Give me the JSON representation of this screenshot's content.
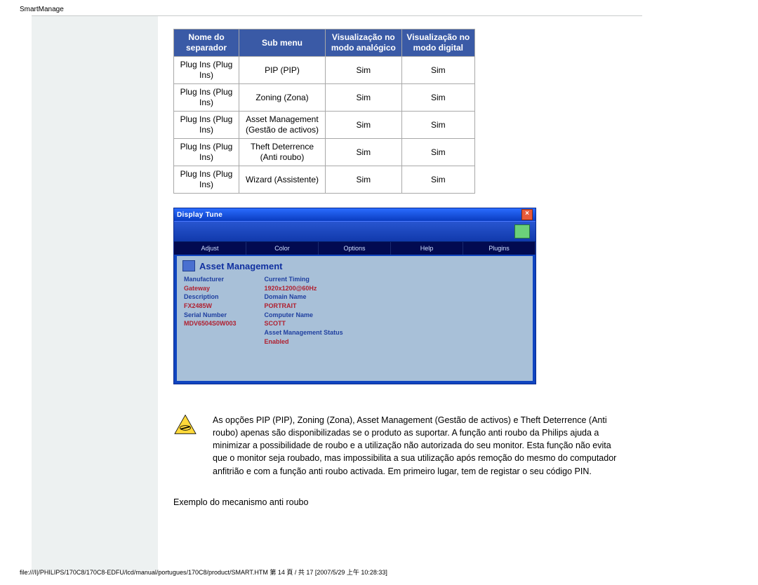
{
  "header": "SmartManage",
  "table": {
    "headers": [
      "Nome do separador",
      "Sub menu",
      "Visualização no modo analógico",
      "Visualização no modo digital"
    ],
    "rows": [
      [
        "Plug Ins (Plug Ins)",
        "PIP (PIP)",
        "Sim",
        "Sim"
      ],
      [
        "Plug Ins (Plug Ins)",
        "Zoning (Zona)",
        "Sim",
        "Sim"
      ],
      [
        "Plug Ins (Plug Ins)",
        "Asset Management (Gestão de activos)",
        "Sim",
        "Sim"
      ],
      [
        "Plug Ins (Plug Ins)",
        "Theft Deterrence (Anti roubo)",
        "Sim",
        "Sim"
      ],
      [
        "Plug Ins (Plug Ins)",
        "Wizard (Assistente)",
        "Sim",
        "Sim"
      ]
    ]
  },
  "shot": {
    "title": "Display Tune",
    "close": "×",
    "tabs": [
      "Adjust",
      "Color",
      "Options",
      "Help",
      "Plugins"
    ],
    "pane_title": "Asset Management",
    "left": [
      {
        "k": "Manufacturer",
        "v": "Gateway"
      },
      {
        "k": "Description",
        "v": "FX2485W"
      },
      {
        "k": "Serial Number",
        "v": "MDV6504S0W003"
      }
    ],
    "right": [
      {
        "k": "Current Timing",
        "v": "1920x1200@60Hz"
      },
      {
        "k": "Domain Name",
        "v": "PORTRAIT"
      },
      {
        "k": "Computer Name",
        "v": "SCOTT"
      },
      {
        "k": "Asset Management Status",
        "v": "Enabled"
      }
    ]
  },
  "note": "As opções PIP (PIP), Zoning (Zona), Asset Management (Gestão de activos) e Theft Deterrence (Anti roubo) apenas são disponibilizadas se o produto as suportar. A função anti roubo da Philips ajuda a minimizar a possibilidade de roubo e a utilização não autorizada do seu monitor. Esta função não evita que o monitor seja roubado, mas impossibilita a sua utilização após remoção do mesmo do computador anfitrião e com a função anti roubo activada. Em primeiro lugar, tem de registar o seu código PIN.",
  "subheading": "Exemplo do mecanismo anti roubo",
  "footer": "file:///I|/PHILIPS/170C8/170C8-EDFU/lcd/manual/portugues/170C8/product/SMART.HTM 第 14 頁 / 共 17 [2007/5/29 上午 10:28:33]"
}
